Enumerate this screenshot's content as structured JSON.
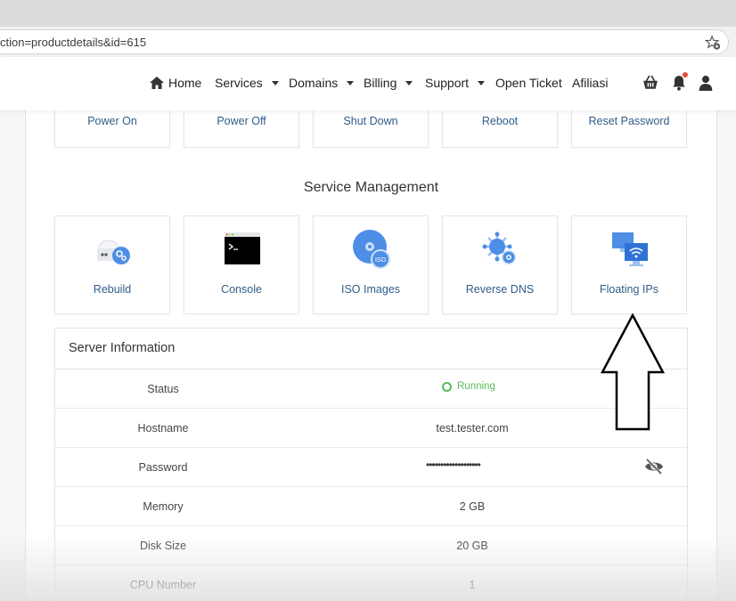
{
  "browser": {
    "url_text": "ction=productdetails&id=615",
    "bookmark_icon": "star-plus-icon"
  },
  "nav": {
    "home": "Home",
    "services": "Services",
    "domains": "Domains",
    "billing": "Billing",
    "support": "Support",
    "open_ticket": "Open Ticket",
    "affiliate": "Afiliasi",
    "icons": [
      "home-icon",
      "basket-icon",
      "bell-icon",
      "user-icon"
    ]
  },
  "power_actions": [
    "Power On",
    "Power Off",
    "Shut Down",
    "Reboot",
    "Reset Password"
  ],
  "service_management": {
    "title": "Service Management",
    "items": [
      {
        "label": "Rebuild",
        "icon": "rebuild-icon"
      },
      {
        "label": "Console",
        "icon": "console-icon"
      },
      {
        "label": "ISO Images",
        "icon": "iso-icon",
        "badge": "ISO"
      },
      {
        "label": "Reverse DNS",
        "icon": "reverse-dns-icon"
      },
      {
        "label": "Floating IPs",
        "icon": "floating-ip-icon"
      }
    ]
  },
  "server_info": {
    "title": "Server Information",
    "status_label": "Status",
    "status_value": "Running",
    "hostname_label": "Hostname",
    "hostname_value": "test.tester.com",
    "password_label": "Password",
    "password_value": "•••••••••••••••••••",
    "memory_label": "Memory",
    "memory_value": "2 GB",
    "disk_label": "Disk Size",
    "disk_value": "20 GB",
    "cpu_label": "CPU Number",
    "cpu_value": "1"
  },
  "colors": {
    "accent_text": "#2f5d8a",
    "status_green": "#5cb85c",
    "notification": "#e74c3c"
  }
}
